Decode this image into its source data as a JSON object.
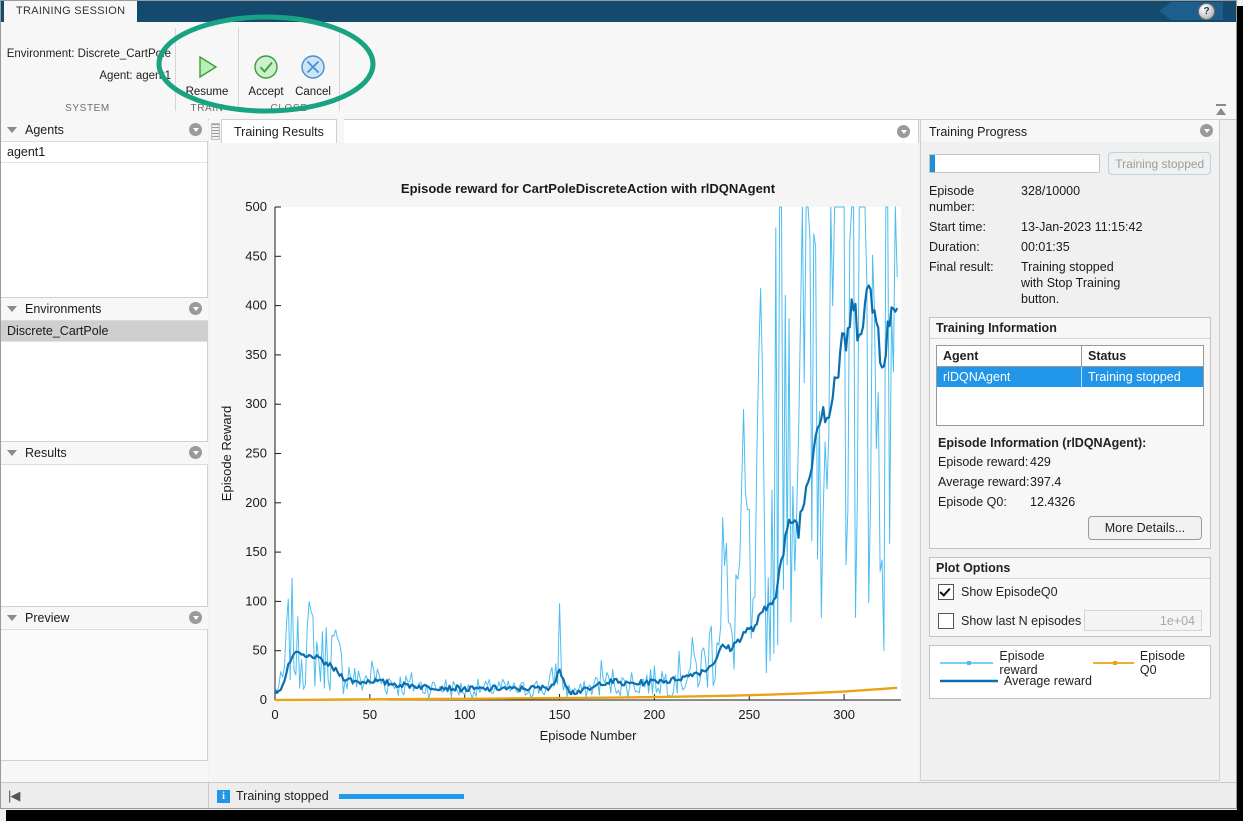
{
  "window": {
    "ribbon_tab": "TRAINING SESSION",
    "help_icon": "help-circle-icon",
    "collapse_icon": "collapse-ribbon-icon"
  },
  "ribbon": {
    "system": {
      "environment_line": "Environment: Discrete_CartPole",
      "agent_line": "Agent: agent1",
      "group_label": "SYSTEM"
    },
    "train": {
      "group_label": "TRAIN",
      "resume_label": "Resume",
      "resume_icon": "play-triangle-icon"
    },
    "close": {
      "group_label": "CLOSE",
      "accept_label": "Accept",
      "accept_icon": "check-circle-icon",
      "cancel_label": "Cancel",
      "cancel_icon": "x-circle-icon"
    },
    "annotation": {
      "shape": "ellipse-highlight",
      "color": "#18a383"
    }
  },
  "sidebar": {
    "panels": [
      {
        "title": "Agents",
        "close_icon": "panel-collapse-icon",
        "items": [
          {
            "label": "agent1",
            "selected": false
          }
        ]
      },
      {
        "title": "Environments",
        "close_icon": "panel-collapse-icon",
        "items": [
          {
            "label": "Discrete_CartPole",
            "selected": true
          }
        ]
      },
      {
        "title": "Results",
        "close_icon": "panel-collapse-icon",
        "items": []
      },
      {
        "title": "Preview",
        "close_icon": "panel-collapse-icon",
        "items": []
      }
    ]
  },
  "center": {
    "tab_label": "Training Results",
    "tab_close_icon": "panel-collapse-icon",
    "grip_icon": "drag-grip-icon"
  },
  "chart_data": {
    "type": "line",
    "title": "Episode reward for CartPoleDiscreteAction with rlDQNAgent",
    "xlabel": "Episode Number",
    "ylabel": "Episode Reward",
    "xlim": [
      0,
      330
    ],
    "ylim": [
      0,
      500
    ],
    "xticks": [
      0,
      50,
      100,
      150,
      200,
      250,
      300
    ],
    "yticks": [
      0,
      50,
      100,
      150,
      200,
      250,
      300,
      350,
      400,
      450,
      500
    ],
    "grid": false,
    "legend_position": "outside-right-panel",
    "series": [
      {
        "name": "Episode reward",
        "color": "#4dbdf0",
        "x": [
          0,
          4,
          8,
          12,
          16,
          20,
          24,
          28,
          32,
          36,
          40,
          44,
          48,
          52,
          56,
          60,
          64,
          68,
          72,
          76,
          80,
          84,
          88,
          92,
          96,
          100,
          104,
          108,
          112,
          116,
          120,
          124,
          128,
          132,
          136,
          140,
          144,
          148,
          150,
          152,
          154,
          156,
          158,
          160,
          164,
          168,
          172,
          176,
          180,
          184,
          188,
          192,
          196,
          200,
          204,
          208,
          212,
          216,
          220,
          224,
          228,
          232,
          236,
          240,
          244,
          248,
          252,
          256,
          260,
          264,
          268,
          272,
          276,
          280,
          284,
          288,
          292,
          296,
          300,
          304,
          308,
          312,
          316,
          320,
          324,
          328
        ],
        "y": [
          9,
          18,
          74,
          46,
          56,
          60,
          38,
          52,
          44,
          30,
          25,
          18,
          22,
          26,
          20,
          19,
          17,
          15,
          16,
          14,
          13,
          12,
          14,
          12,
          11,
          11,
          10,
          12,
          11,
          13,
          12,
          11,
          10,
          11,
          13,
          12,
          11,
          28,
          63,
          15,
          10,
          9,
          10,
          9,
          11,
          13,
          24,
          16,
          21,
          14,
          18,
          17,
          20,
          19,
          22,
          18,
          28,
          24,
          35,
          30,
          44,
          62,
          150,
          48,
          120,
          175,
          60,
          240,
          92,
          270,
          500,
          335,
          180,
          500,
          420,
          500,
          260,
          500,
          445,
          500,
          410,
          500,
          300,
          220,
          500,
          429
        ]
      },
      {
        "name": "Average reward",
        "color": "#0b6fb0",
        "x": [
          0,
          4,
          8,
          12,
          16,
          20,
          24,
          28,
          32,
          36,
          40,
          44,
          48,
          52,
          56,
          60,
          64,
          68,
          72,
          76,
          80,
          84,
          88,
          92,
          96,
          100,
          104,
          108,
          112,
          116,
          120,
          124,
          128,
          132,
          136,
          140,
          144,
          148,
          150,
          152,
          154,
          156,
          158,
          160,
          164,
          168,
          172,
          176,
          180,
          184,
          188,
          192,
          196,
          200,
          204,
          208,
          212,
          216,
          220,
          224,
          228,
          232,
          236,
          240,
          244,
          248,
          252,
          256,
          260,
          264,
          268,
          272,
          276,
          280,
          284,
          288,
          292,
          296,
          300,
          304,
          308,
          312,
          316,
          320,
          324,
          328
        ],
        "y": [
          8,
          14,
          40,
          48,
          43,
          45,
          40,
          36,
          30,
          23,
          20,
          18,
          19,
          20,
          18,
          17,
          16,
          15,
          15,
          14,
          13,
          13,
          13,
          12,
          12,
          11,
          11,
          11,
          11,
          12,
          12,
          11,
          11,
          12,
          12,
          12,
          13,
          18,
          32,
          22,
          14,
          8,
          8,
          9,
          10,
          12,
          18,
          18,
          19,
          16,
          17,
          17,
          18,
          19,
          20,
          19,
          22,
          23,
          27,
          28,
          32,
          40,
          55,
          52,
          60,
          70,
          72,
          85,
          95,
          110,
          150,
          185,
          175,
          215,
          260,
          300,
          290,
          330,
          360,
          390,
          385,
          410,
          395,
          350,
          380,
          397.4
        ]
      },
      {
        "name": "Episode Q0",
        "color": "#e8a317",
        "x": [
          0,
          20,
          40,
          60,
          80,
          100,
          120,
          140,
          160,
          180,
          200,
          220,
          240,
          260,
          280,
          300,
          320,
          328
        ],
        "y": [
          0.1,
          0.2,
          0.5,
          0.8,
          1.0,
          1.2,
          1.5,
          1.8,
          2.1,
          2.5,
          3.0,
          3.6,
          4.4,
          5.4,
          6.8,
          8.6,
          11.2,
          12.4
        ]
      }
    ]
  },
  "training_progress": {
    "panel_title": "Training Progress",
    "close_icon": "panel-collapse-icon",
    "progress_percent": 3,
    "progress_color": "#1e90d6",
    "stop_button_label": "Training stopped",
    "fields": [
      {
        "key": "Episode number:",
        "value": "328/10000"
      },
      {
        "key": "Start time:",
        "value": "13-Jan-2023 11:15:42"
      },
      {
        "key": "Duration:",
        "value": "00:01:35"
      },
      {
        "key": "Final result:",
        "value": "Training stopped with Stop Training button."
      }
    ],
    "training_information": {
      "title": "Training Information",
      "columns": [
        "Agent",
        "Status"
      ],
      "rows": [
        {
          "agent": "rlDQNAgent",
          "status": "Training stopped",
          "selected": true
        }
      ],
      "row_highlight_color": "#2196e8"
    },
    "episode_information": {
      "title": "Episode Information (rlDQNAgent):",
      "fields": [
        {
          "key": "Episode reward:",
          "value": "429"
        },
        {
          "key": "Average reward:",
          "value": "397.4"
        },
        {
          "key": "Episode Q0:",
          "value": "12.4326"
        }
      ],
      "more_details_label": "More Details..."
    },
    "plot_options": {
      "title": "Plot Options",
      "show_episode_q0": {
        "label": "Show EpisodeQ0",
        "checked": true
      },
      "show_last_n": {
        "label": "Show last N episodes",
        "checked": false,
        "field_value": "1e+04"
      }
    },
    "legend": [
      {
        "label": "Episode reward",
        "color": "#4dbdf0"
      },
      {
        "label": "Episode Q0",
        "color": "#e8a317"
      },
      {
        "label": "Average reward",
        "color": "#0b6fb0"
      }
    ]
  },
  "statusbar": {
    "first_icon": "go-to-start-icon",
    "info_icon": "info-icon",
    "info_glyph": "i",
    "message": "Training stopped",
    "bar_color": "#1e9ae8"
  }
}
